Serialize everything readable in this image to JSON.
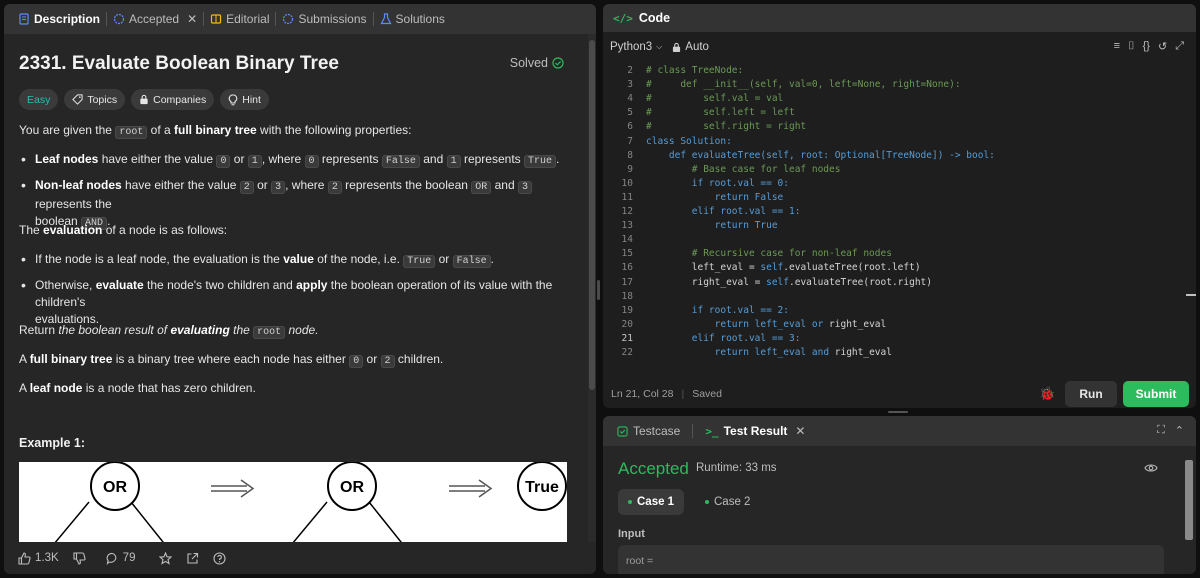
{
  "left_tabs": [
    {
      "label": "Description",
      "active": true
    },
    {
      "label": "Accepted",
      "active": false
    },
    {
      "label": "Editorial",
      "active": false
    },
    {
      "label": "Submissions",
      "active": false
    },
    {
      "label": "Solutions",
      "active": false
    }
  ],
  "problem": {
    "title": "2331. Evaluate Boolean Binary Tree",
    "status": "Solved",
    "difficulty": "Easy",
    "chips": [
      "Topics",
      "Companies",
      "Hint"
    ],
    "intro": {
      "pre": "You are given the ",
      "code": "root",
      "mid": " of a ",
      "bold": "full binary tree",
      "post": " with the following properties:"
    },
    "bullet1": {
      "bold": "Leaf nodes",
      "t1": " have either the value ",
      "c1": "0",
      "t2": " or ",
      "c2": "1",
      "t3": ", where ",
      "c3": "0",
      "t4": " represents ",
      "c4": "False",
      "t5": " and ",
      "c5": "1",
      "t6": " represents ",
      "c6": "True",
      "t7": "."
    },
    "bullet2": {
      "bold": "Non-leaf nodes",
      "t1": " have either the value ",
      "c1": "2",
      "t2": " or ",
      "c2": "3",
      "t3": ", where ",
      "c3": "2",
      "t4": " represents the boolean ",
      "c4": "OR",
      "t5": " and ",
      "c5": "3",
      "t6": " represents the",
      "t7": "boolean ",
      "c6": "AND",
      "t8": "."
    },
    "eval_line": {
      "pre": "The ",
      "bold": "evaluation",
      "post": " of a node is as follows:"
    },
    "bullet3": {
      "t1": "If the node is a leaf node, the evaluation is the ",
      "bold": "value",
      "t2": " of the node, i.e. ",
      "c1": "True",
      "t3": " or ",
      "c2": "False",
      "t4": "."
    },
    "bullet4": {
      "t1": "Otherwise, ",
      "b1": "evaluate",
      "t2": " the node's two children and ",
      "b2": "apply",
      "t3": " the boolean operation of its value with the children's",
      "t4": "evaluations."
    },
    "return_line": {
      "pre": "Return ",
      "i1": "the boolean result of ",
      "b1": "evaluating",
      "i2": " the ",
      "code": "root",
      "i3": " node."
    },
    "full_line": {
      "pre": "A ",
      "bold": "full binary tree",
      "mid": " is a binary tree where each node has either ",
      "c1": "0",
      "t2": " or ",
      "c2": "2",
      "post": " children."
    },
    "leaf_line": {
      "pre": "A ",
      "bold": "leaf node",
      "post": " is a node that has zero children."
    },
    "example_title": "Example 1:",
    "tree_labels": [
      "OR",
      "OR",
      "True"
    ]
  },
  "footer": {
    "likes": "1.3K",
    "comments": "79"
  },
  "code_panel": {
    "title": "Code",
    "language": "Python3",
    "mode": "Auto",
    "lines": [
      {
        "n": "2",
        "segments": [
          {
            "t": "# class TreeNode:",
            "c": "cm"
          }
        ]
      },
      {
        "n": "3",
        "segments": [
          {
            "t": "#     def __init__(self, val=0, left=None, right=None):",
            "c": "cm"
          }
        ]
      },
      {
        "n": "4",
        "segments": [
          {
            "t": "#         self.val = val",
            "c": "cm"
          }
        ]
      },
      {
        "n": "5",
        "segments": [
          {
            "t": "#         self.left = left",
            "c": "cm"
          }
        ]
      },
      {
        "n": "6",
        "segments": [
          {
            "t": "#         self.right = right",
            "c": "cm"
          }
        ]
      },
      {
        "n": "7",
        "segments": [
          {
            "t": "class Solution:",
            "c": "kw"
          }
        ]
      },
      {
        "n": "8",
        "segments": [
          {
            "t": "    def evaluateTree(self, root: Optional[TreeNode]) -> ",
            "c": "kw"
          },
          {
            "t": "bool:",
            "c": "kw"
          }
        ]
      },
      {
        "n": "9",
        "segments": [
          {
            "t": "        # Base case for leaf nodes",
            "c": "cm"
          }
        ]
      },
      {
        "n": "10",
        "segments": [
          {
            "t": "        if root.val == 0:",
            "c": "kw"
          }
        ]
      },
      {
        "n": "11",
        "segments": [
          {
            "t": "            return ",
            "c": "kw"
          },
          {
            "t": "False",
            "c": "lit"
          }
        ]
      },
      {
        "n": "12",
        "segments": [
          {
            "t": "        elif root.val == 1:",
            "c": "kw"
          }
        ]
      },
      {
        "n": "13",
        "segments": [
          {
            "t": "            return ",
            "c": "kw"
          },
          {
            "t": "True",
            "c": "lit"
          }
        ]
      },
      {
        "n": "14",
        "segments": [
          {
            "t": "",
            "c": ""
          }
        ]
      },
      {
        "n": "15",
        "segments": [
          {
            "t": "        # Recursive case for non-leaf nodes",
            "c": "cm"
          }
        ]
      },
      {
        "n": "16",
        "segments": [
          {
            "t": "        left_eval = ",
            "c": ""
          },
          {
            "t": "self",
            "c": "kw"
          },
          {
            "t": ".evaluateTree(root.left)",
            "c": ""
          }
        ]
      },
      {
        "n": "17",
        "segments": [
          {
            "t": "        right_eval = ",
            "c": ""
          },
          {
            "t": "self",
            "c": "kw"
          },
          {
            "t": ".evaluateTree(root.right)",
            "c": ""
          }
        ]
      },
      {
        "n": "18",
        "segments": [
          {
            "t": "",
            "c": ""
          }
        ]
      },
      {
        "n": "19",
        "segments": [
          {
            "t": "        if root.val == 2:",
            "c": "kw"
          }
        ]
      },
      {
        "n": "20",
        "segments": [
          {
            "t": "            return left_eval ",
            "c": "kw"
          },
          {
            "t": "or",
            "c": "kw"
          },
          {
            "t": " right_eval",
            "c": ""
          }
        ]
      },
      {
        "n": "21",
        "segments": [
          {
            "t": "        elif root.val == 3:",
            "c": "kw"
          }
        ]
      },
      {
        "n": "22",
        "segments": [
          {
            "t": "            return left_eval ",
            "c": "kw"
          },
          {
            "t": "and",
            "c": "kw"
          },
          {
            "t": " right_eval",
            "c": ""
          }
        ]
      }
    ],
    "cursor_line": "21",
    "status_pos": "Ln 21, Col 28",
    "status_saved": "Saved",
    "run_label": "Run",
    "submit_label": "Submit"
  },
  "test_panel": {
    "tabs": [
      "Testcase",
      "Test Result"
    ],
    "result": "Accepted",
    "runtime": "Runtime: 33 ms",
    "cases": [
      "Case 1",
      "Case 2"
    ],
    "input_label": "Input",
    "input_value": "root ="
  },
  "colors": {
    "accent_green": "#2cbb5d",
    "easy": "#2cbbb2",
    "comment": "#6a9955",
    "keyword": "#569cd6"
  }
}
